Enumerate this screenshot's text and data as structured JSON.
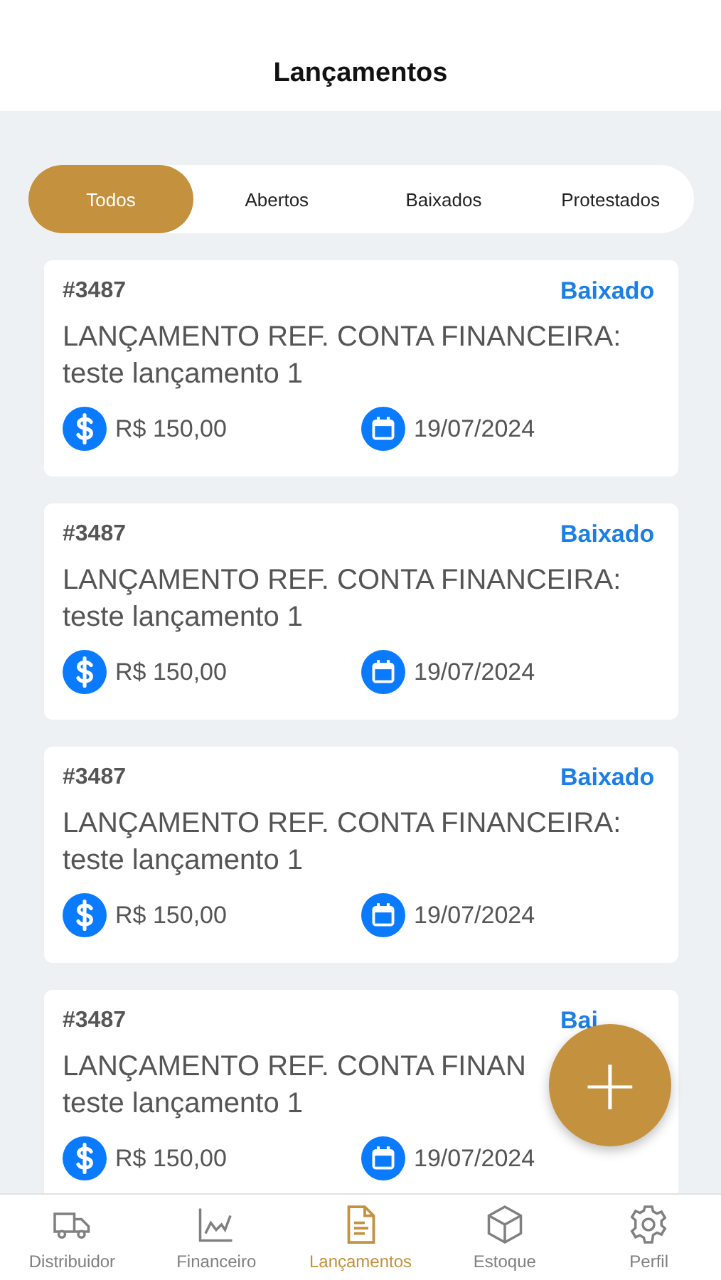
{
  "header": {
    "title": "Lançamentos"
  },
  "filters": [
    {
      "label": "Todos",
      "selected": true
    },
    {
      "label": "Abertos",
      "selected": false
    },
    {
      "label": "Baixados",
      "selected": false
    },
    {
      "label": "Protestados",
      "selected": false
    }
  ],
  "entries": [
    {
      "number": "#3487",
      "status": "Baixado",
      "title_lines": [
        "LANÇAMENTO REF. CONTA FINANCEIRA:",
        "teste lançamento 1"
      ],
      "amount": "R$ 150,00",
      "date": "19/07/2024"
    },
    {
      "number": "#3487",
      "status": "Baixado",
      "title_lines": [
        "LANÇAMENTO REF. CONTA FINANCEIRA:",
        "teste lançamento 1"
      ],
      "amount": "R$ 150,00",
      "date": "19/07/2024"
    },
    {
      "number": "#3487",
      "status": "Baixado",
      "title_lines": [
        "LANÇAMENTO REF. CONTA FINANCEIRA:",
        "teste lançamento 1"
      ],
      "amount": "R$ 150,00",
      "date": "19/07/2024"
    },
    {
      "number": "#3487",
      "status": "Bai",
      "title_lines": [
        "LANÇAMENTO REF. CONTA FINAN",
        "teste lançamento 1"
      ],
      "amount": "R$ 150,00",
      "date": "19/07/2024"
    }
  ],
  "add_button": {
    "label": "+"
  },
  "tab_bar": [
    {
      "label": "Distribuidor",
      "selected": false
    },
    {
      "label": "Financeiro",
      "selected": false
    },
    {
      "label": "Lançamentos",
      "selected": true
    },
    {
      "label": "Estoque",
      "selected": false
    },
    {
      "label": "Perfil",
      "selected": false
    }
  ]
}
